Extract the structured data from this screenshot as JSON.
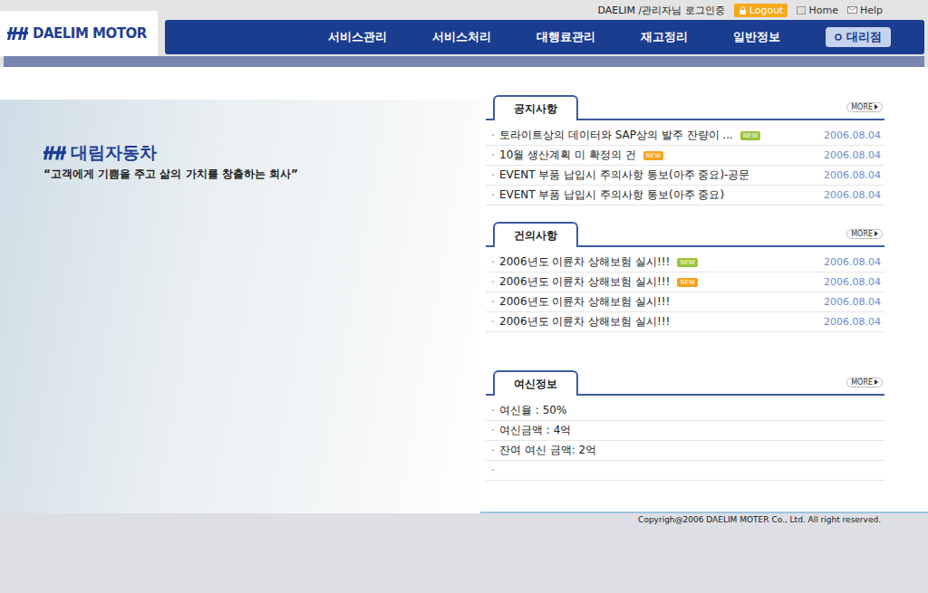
{
  "header": {
    "logo": "DAELIM MOTOR",
    "user": "DAELIM  /관리자님 로그인중",
    "logout": "Logout",
    "home": "Home",
    "help": "Help"
  },
  "nav": [
    "서비스관리",
    "서비스처리",
    "대행료관리",
    "재고정리",
    "일반정보"
  ],
  "branch_button": "대리점",
  "hero": {
    "logo": "대림자동차",
    "slogan": "“고객에게 기쁨을 주고 삶의 가치를 창출하는 회사”"
  },
  "sections": [
    {
      "title": "공지사항",
      "more": "MORE",
      "rows": [
        {
          "text": "토라이트상의 데이터와 SAP상의 발주 잔량이 ...",
          "badge": {
            "text": "NEW",
            "color": "#99c43a"
          },
          "date": "2006.08.04"
        },
        {
          "text": "10월 생산계획 미 확정의 건",
          "badge": {
            "text": "NEW",
            "color": "#f5a21c"
          },
          "date": "2006.08.04"
        },
        {
          "text": "EVENT 부품 납입시 주의사항 통보(아주 중요)-공문",
          "date": "2006.08.04"
        },
        {
          "text": "EVENT 부품 납입시 주의사항 통보(아주 중요)",
          "date": "2006.08.04"
        }
      ]
    },
    {
      "title": "건의사항",
      "more": "MORE",
      "rows": [
        {
          "text": "2006년도 이륜차 상해보험 실시!!!",
          "badge": {
            "text": "NEW",
            "color": "#99c43a"
          },
          "date": "2006.08.04"
        },
        {
          "text": "2006년도 이륜차 상해보험 실시!!!",
          "badge": {
            "text": "NEW",
            "color": "#f5a21c"
          },
          "date": "2006.08.04"
        },
        {
          "text": "2006년도 이륜차 상해보험 실시!!!",
          "date": "2006.08.04"
        },
        {
          "text": "2006년도 이륜차 상해보험 실시!!!",
          "date": "2006.08.04"
        }
      ]
    },
    {
      "title": "여신정보",
      "more": "MORE",
      "rows": [
        {
          "text": "여신율 : 50%"
        },
        {
          "text": "여신금액 : 4억"
        },
        {
          "text": "잔여 여신 금액: 2억"
        },
        {
          "text": ""
        }
      ]
    }
  ],
  "footer": "Copyrigh@2006 DAELIM MOTER Co., Ltd. All right reserved."
}
